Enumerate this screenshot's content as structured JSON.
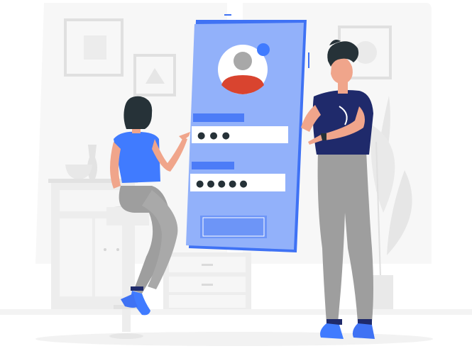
{
  "login_form": {
    "username_mask": "●●●",
    "password_mask": "●●●●●"
  },
  "colors": {
    "phone_fill": "#92B1FA",
    "phone_edge": "#3F72F4",
    "accent_blue": "#407BFF",
    "field_label": "#4C7CF7",
    "shirt_navy": "#1F2A6B",
    "hair_dark": "#263238",
    "skin": "#F0A58B",
    "trousers": "#9E9E9E",
    "avatar_red": "#D9442F",
    "room_gray": "#EBEBEB",
    "room_line": "#DADADA"
  }
}
